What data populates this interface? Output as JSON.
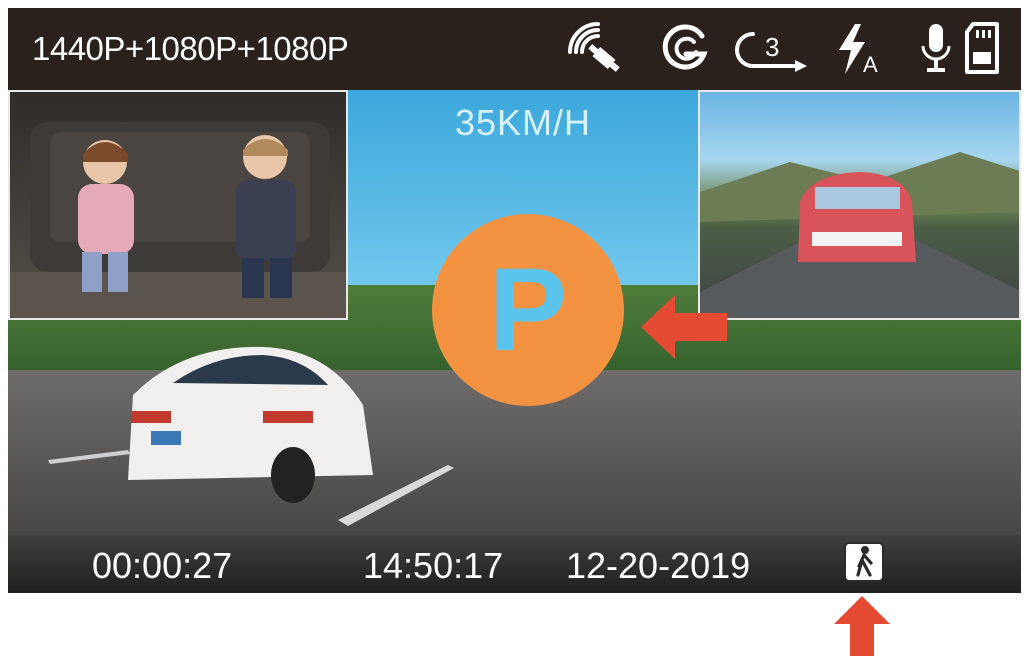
{
  "status_bar": {
    "resolution": "1440P+1080P+1080P",
    "loop_interval": "3",
    "flash_label": "A",
    "icons": [
      "gps-signal-icon",
      "g-sensor-icon",
      "loop-recording-icon",
      "auto-flash-icon",
      "microphone-icon",
      "sd-card-icon"
    ]
  },
  "overlay": {
    "speed": "35KM/H",
    "parking_mode_letter": "P",
    "parking_color": "#f39342",
    "arrow_color": "#e54b33"
  },
  "footer": {
    "elapsed": "00:00:27",
    "time": "14:50:17",
    "date": "12-20-2019",
    "icons": [
      "pedestrian-icon"
    ]
  }
}
